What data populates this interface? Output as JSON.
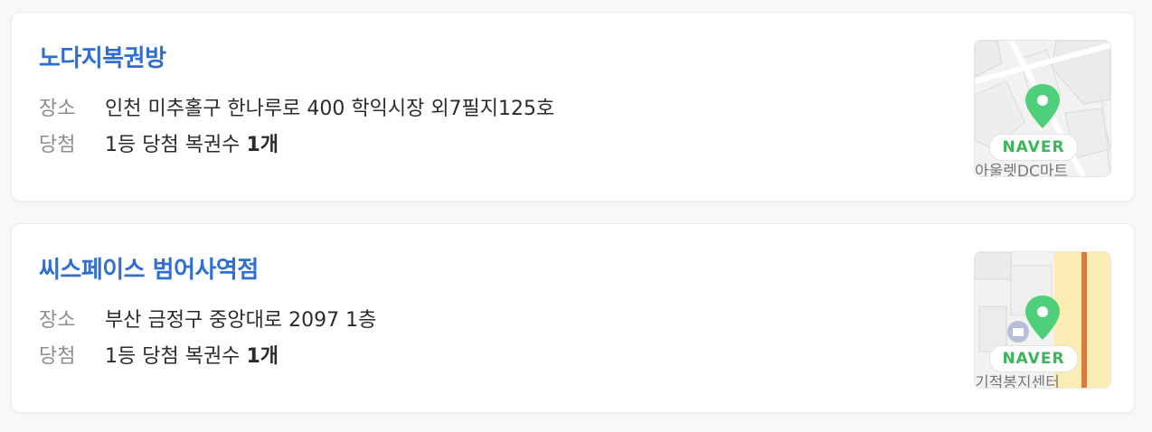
{
  "results": [
    {
      "name": "노다지복권방",
      "place_label": "장소",
      "address": "인천 미추홀구 한나루로 400 학익시장 외7필지125호",
      "win_label": "당첨",
      "win_text": "1등 당첨 복권수",
      "win_count": "1개",
      "map_badge": "NAVER",
      "map_caption": "아울렛DC마트"
    },
    {
      "name": "씨스페이스 범어사역점",
      "place_label": "장소",
      "address": "부산 금정구 중앙대로 2097 1층",
      "win_label": "당첨",
      "win_text": "1등 당첨 복권수",
      "win_count": "1개",
      "map_badge": "NAVER",
      "map_caption": "기적봉지센터"
    }
  ],
  "colors": {
    "title": "#2f6fd0",
    "pin": "#4fcf7a",
    "badge_text": "#3cb55a"
  }
}
